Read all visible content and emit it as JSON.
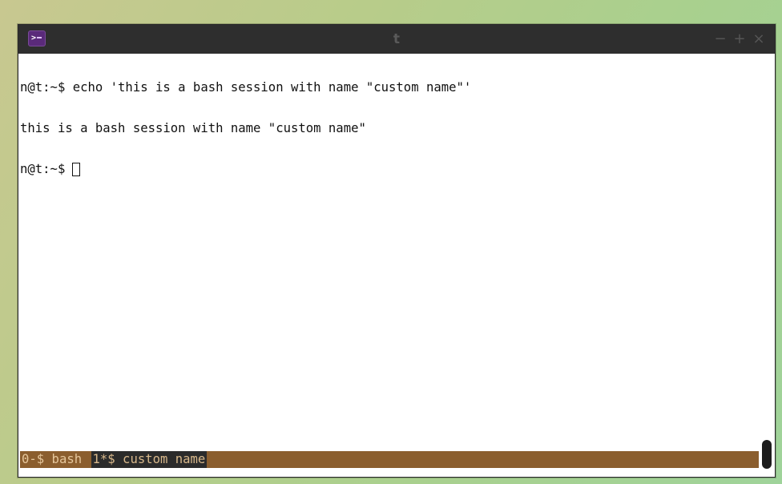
{
  "window": {
    "title": "t",
    "icon": "terminal-icon",
    "controls": {
      "minimize": "−",
      "maximize": "+",
      "close": "×"
    }
  },
  "terminal": {
    "lines": [
      "n@t:~$ echo 'this is a bash session with name \"custom name\"'",
      "this is a bash session with name \"custom name\"",
      "n@t:~$"
    ]
  },
  "status_bar": {
    "items": [
      {
        "label": "0-$ bash",
        "active": false
      },
      {
        "label": "1*$ custom name",
        "active": true
      }
    ],
    "colors": {
      "background": "#8b5e2e",
      "active_background": "#2b2b2b"
    }
  }
}
